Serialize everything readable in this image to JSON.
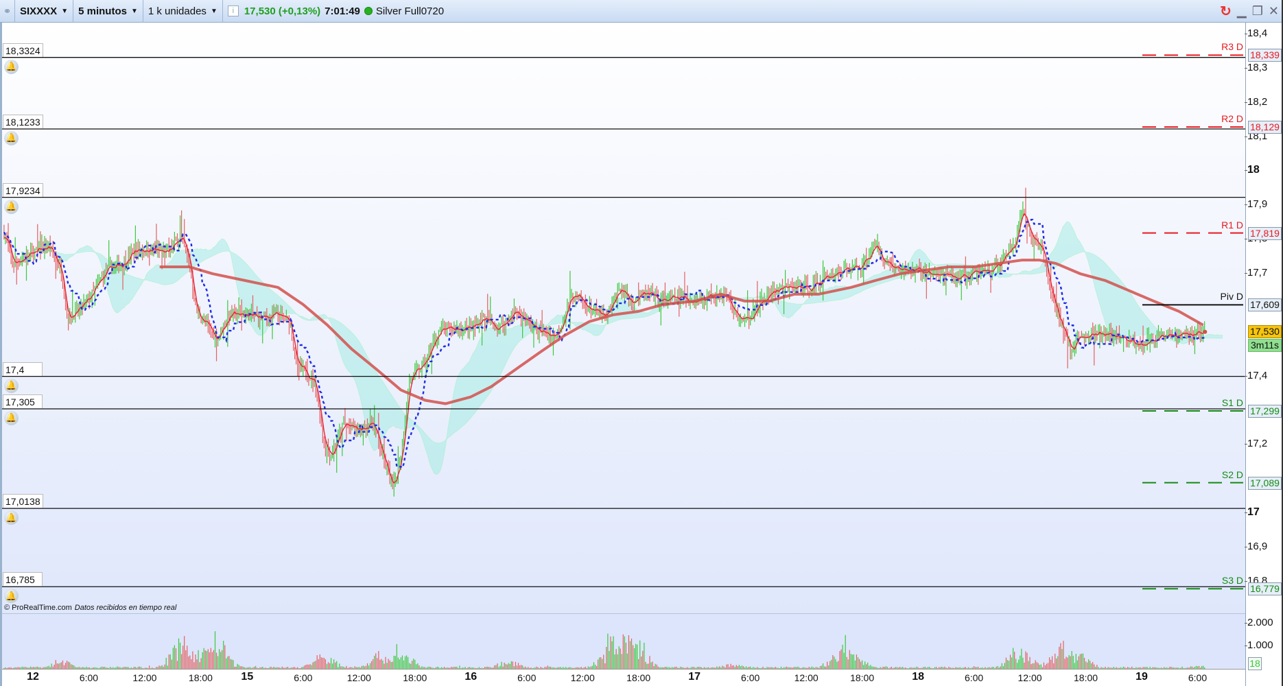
{
  "toolbar": {
    "symbol": "SIXXXX",
    "timeframe": "5 minutos",
    "units": "1 k unidades",
    "price": "17,530 (+0,13%)",
    "time": "7:01:49",
    "account": "Silver Full0720"
  },
  "alert_levels": [
    {
      "label": "18,3324",
      "value": 18.3324
    },
    {
      "label": "18,1233",
      "value": 18.1233
    },
    {
      "label": "17,9234",
      "value": 17.9234
    },
    {
      "label": "17,4",
      "value": 17.4
    },
    {
      "label": "17,305",
      "value": 17.305
    },
    {
      "label": "17,0138",
      "value": 17.0138
    },
    {
      "label": "16,785",
      "value": 16.785
    }
  ],
  "pivots": [
    {
      "name": "R3 D",
      "label": "18,339",
      "value": 18.339,
      "color": "#e8191f"
    },
    {
      "name": "R2 D",
      "label": "18,129",
      "value": 18.129,
      "color": "#e8191f"
    },
    {
      "name": "R1 D",
      "label": "17,819",
      "value": 17.819,
      "color": "#e8191f"
    },
    {
      "name": "Piv D",
      "label": "17,609",
      "value": 17.609,
      "color": "#111111"
    },
    {
      "name": "S1 D",
      "label": "17,299",
      "value": 17.299,
      "color": "#138a13"
    },
    {
      "name": "S2 D",
      "label": "17,089",
      "value": 17.089,
      "color": "#138a13"
    },
    {
      "name": "S3 D",
      "label": "16,779",
      "value": 16.779,
      "color": "#138a13"
    }
  ],
  "current": {
    "price_label": "17,530",
    "value": 17.53,
    "countdown": "3m11s"
  },
  "attribution": {
    "copyright": "© ProRealTime.com",
    "status": "Datos recibidos en tiempo real"
  },
  "volume_axis": {
    "ticks": [
      {
        "label": "2.000",
        "value": 2000
      },
      {
        "label": "1.000",
        "value": 1000
      }
    ],
    "current": "18"
  },
  "chart_data": {
    "type": "candlestick",
    "price_axis": {
      "range": [
        16.75,
        18.42
      ],
      "ticks": [
        {
          "label": "18,4",
          "v": 18.4
        },
        {
          "label": "18,3",
          "v": 18.3
        },
        {
          "label": "18,2",
          "v": 18.2
        },
        {
          "label": "18,1",
          "v": 18.1
        },
        {
          "label": "18",
          "v": 18,
          "bold": true
        },
        {
          "label": "17,9",
          "v": 17.9
        },
        {
          "label": "17,8",
          "v": 17.8
        },
        {
          "label": "17,7",
          "v": 17.7
        },
        {
          "label": "17,4",
          "v": 17.4
        },
        {
          "label": "17,2",
          "v": 17.2
        },
        {
          "label": "17",
          "v": 17,
          "bold": true
        },
        {
          "label": "16,9",
          "v": 16.9
        },
        {
          "label": "16,8",
          "v": 16.8
        }
      ]
    },
    "x_axis": {
      "unit": "trading hours",
      "ticks": [
        {
          "label": "12",
          "t": 0,
          "bold": true
        },
        {
          "label": "6:00",
          "t": 6
        },
        {
          "label": "12:00",
          "t": 12
        },
        {
          "label": "18:00",
          "t": 18
        },
        {
          "label": "15",
          "t": 23,
          "bold": true
        },
        {
          "label": "6:00",
          "t": 29
        },
        {
          "label": "12:00",
          "t": 35
        },
        {
          "label": "18:00",
          "t": 41
        },
        {
          "label": "16",
          "t": 47,
          "bold": true
        },
        {
          "label": "6:00",
          "t": 53
        },
        {
          "label": "12:00",
          "t": 59
        },
        {
          "label": "18:00",
          "t": 65
        },
        {
          "label": "17",
          "t": 71,
          "bold": true
        },
        {
          "label": "6:00",
          "t": 77
        },
        {
          "label": "12:00",
          "t": 83
        },
        {
          "label": "18:00",
          "t": 89
        },
        {
          "label": "18",
          "t": 95,
          "bold": true
        },
        {
          "label": "6:00",
          "t": 101
        },
        {
          "label": "12:00",
          "t": 107
        },
        {
          "label": "18:00",
          "t": 113
        },
        {
          "label": "19",
          "t": 119,
          "bold": true
        },
        {
          "label": "6:00",
          "t": 125
        }
      ]
    },
    "close": [
      [
        -3.1,
        17.82
      ],
      [
        -2.2,
        17.73
      ],
      [
        0,
        17.76
      ],
      [
        1.7,
        17.78
      ],
      [
        3.05,
        17.71
      ],
      [
        3.7,
        17.57
      ],
      [
        4.8,
        17.59
      ],
      [
        6.1,
        17.63
      ],
      [
        7.9,
        17.71
      ],
      [
        9.6,
        17.73
      ],
      [
        11,
        17.77
      ],
      [
        12.7,
        17.77
      ],
      [
        14.5,
        17.76
      ],
      [
        15.8,
        17.81
      ],
      [
        16.8,
        17.73
      ],
      [
        17.5,
        17.59
      ],
      [
        18.9,
        17.54
      ],
      [
        19.7,
        17.51
      ],
      [
        21.1,
        17.58
      ],
      [
        22.8,
        17.58
      ],
      [
        24.6,
        17.57
      ],
      [
        26.3,
        17.58
      ],
      [
        27.6,
        17.56
      ],
      [
        28.3,
        17.43
      ],
      [
        29.4,
        17.41
      ],
      [
        30.3,
        17.38
      ],
      [
        31.2,
        17.21
      ],
      [
        32,
        17.17
      ],
      [
        33.4,
        17.26
      ],
      [
        35.1,
        17.24
      ],
      [
        36.4,
        17.27
      ],
      [
        37.7,
        17.15
      ],
      [
        38.6,
        17.07
      ],
      [
        39.5,
        17.17
      ],
      [
        40.4,
        17.39
      ],
      [
        42.1,
        17.44
      ],
      [
        43.5,
        17.53
      ],
      [
        45.2,
        17.54
      ],
      [
        47,
        17.54
      ],
      [
        48.3,
        17.57
      ],
      [
        50,
        17.54
      ],
      [
        51.8,
        17.59
      ],
      [
        54.4,
        17.53
      ],
      [
        56.2,
        17.52
      ],
      [
        57.9,
        17.64
      ],
      [
        59.7,
        17.6
      ],
      [
        61.5,
        17.57
      ],
      [
        63,
        17.66
      ],
      [
        64.1,
        17.62
      ],
      [
        65.8,
        17.64
      ],
      [
        67.6,
        17.62
      ],
      [
        69.4,
        17.63
      ],
      [
        71.1,
        17.62
      ],
      [
        72.9,
        17.64
      ],
      [
        74.2,
        17.64
      ],
      [
        75.5,
        17.58
      ],
      [
        76.4,
        17.56
      ],
      [
        77.7,
        17.6
      ],
      [
        79.5,
        17.65
      ],
      [
        81.7,
        17.66
      ],
      [
        83.4,
        17.66
      ],
      [
        85.2,
        17.69
      ],
      [
        86.9,
        17.71
      ],
      [
        88.7,
        17.72
      ],
      [
        90.4,
        17.78
      ],
      [
        91.7,
        17.73
      ],
      [
        93.1,
        17.71
      ],
      [
        94.8,
        17.71
      ],
      [
        96.6,
        17.7
      ],
      [
        98.3,
        17.69
      ],
      [
        100.1,
        17.69
      ],
      [
        101.9,
        17.71
      ],
      [
        103.6,
        17.72
      ],
      [
        105.4,
        17.79
      ],
      [
        106.2,
        17.88
      ],
      [
        107.1,
        17.81
      ],
      [
        108.2,
        17.78
      ],
      [
        108.9,
        17.69
      ],
      [
        109.8,
        17.59
      ],
      [
        110.6,
        17.54
      ],
      [
        111.5,
        17.47
      ],
      [
        112.4,
        17.52
      ],
      [
        114.1,
        17.52
      ],
      [
        115.9,
        17.52
      ],
      [
        117.7,
        17.5
      ],
      [
        119.4,
        17.5
      ],
      [
        121.2,
        17.51
      ],
      [
        123,
        17.52
      ],
      [
        125.8,
        17.53
      ]
    ],
    "moving_average": [
      [
        13.6,
        17.72
      ],
      [
        16.8,
        17.72
      ],
      [
        19.3,
        17.7
      ],
      [
        22.8,
        17.68
      ],
      [
        26.3,
        17.66
      ],
      [
        29,
        17.61
      ],
      [
        31.6,
        17.55
      ],
      [
        34.2,
        17.48
      ],
      [
        36.9,
        17.42
      ],
      [
        39.5,
        17.36
      ],
      [
        42.1,
        17.33
      ],
      [
        44.3,
        17.32
      ],
      [
        47,
        17.34
      ],
      [
        49.2,
        17.37
      ],
      [
        51.8,
        17.42
      ],
      [
        54.4,
        17.47
      ],
      [
        57.1,
        17.52
      ],
      [
        59.7,
        17.56
      ],
      [
        62.3,
        17.58
      ],
      [
        65,
        17.59
      ],
      [
        67.6,
        17.61
      ],
      [
        71.1,
        17.62
      ],
      [
        73.8,
        17.64
      ],
      [
        76.4,
        17.62
      ],
      [
        79,
        17.62
      ],
      [
        81.7,
        17.64
      ],
      [
        84.3,
        17.64
      ],
      [
        87.8,
        17.66
      ],
      [
        90.4,
        17.68
      ],
      [
        93.1,
        17.7
      ],
      [
        95.7,
        17.71
      ],
      [
        98.3,
        17.72
      ],
      [
        101,
        17.72
      ],
      [
        103.6,
        17.73
      ],
      [
        106.2,
        17.74
      ],
      [
        108,
        17.74
      ],
      [
        109.8,
        17.73
      ],
      [
        112.4,
        17.7
      ],
      [
        115.1,
        17.68
      ],
      [
        117.7,
        17.65
      ],
      [
        120.3,
        17.62
      ],
      [
        123,
        17.59
      ],
      [
        125.6,
        17.55
      ]
    ],
    "volume_peaks": [
      [
        0,
        100
      ],
      [
        3,
        450
      ],
      [
        16.2,
        1500
      ],
      [
        17,
        1100
      ],
      [
        19.5,
        1700
      ],
      [
        31.2,
        700
      ],
      [
        37.3,
        800
      ],
      [
        39.5,
        900
      ],
      [
        51,
        400
      ],
      [
        63,
        2100
      ],
      [
        64.5,
        1500
      ],
      [
        62,
        900
      ],
      [
        75,
        250
      ],
      [
        87,
        1100
      ],
      [
        88,
        700
      ],
      [
        106,
        1000
      ],
      [
        110.6,
        1300
      ],
      [
        112,
        800
      ],
      [
        125,
        150
      ]
    ]
  }
}
